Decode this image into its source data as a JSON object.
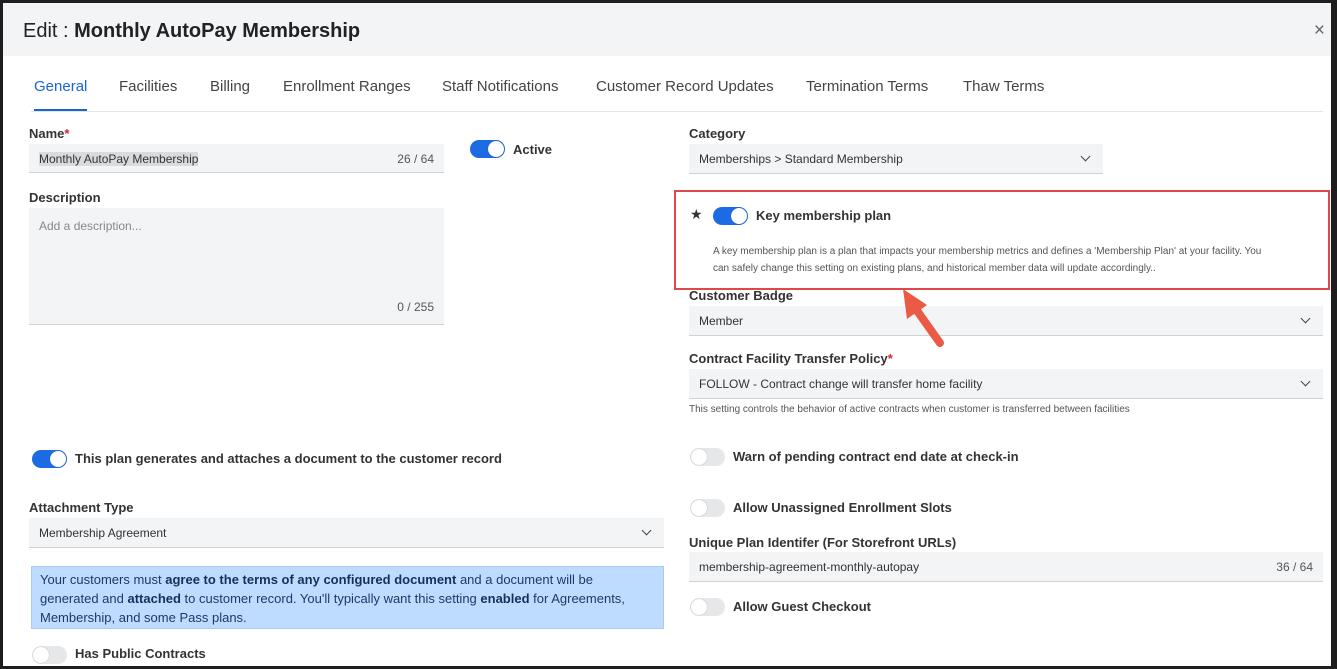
{
  "modal": {
    "title_prefix": "Edit : ",
    "title_name": "Monthly AutoPay Membership",
    "close_glyph": "×"
  },
  "tabs": [
    "General",
    "Facilities",
    "Billing",
    "Enrollment Ranges",
    "Staff Notifications",
    "Customer Record Updates",
    "Termination Terms",
    "Thaw Terms"
  ],
  "name_field": {
    "label": "Name",
    "required_mark": "*",
    "value": "Monthly AutoPay Membership",
    "counter": "26 / 64"
  },
  "active": {
    "label": "Active",
    "on": true
  },
  "description": {
    "label": "Description",
    "placeholder": "Add a description...",
    "counter": "0 / 255"
  },
  "category": {
    "label": "Category",
    "value": "Memberships > Standard Membership"
  },
  "key_plan": {
    "star_glyph": "★",
    "label": "Key membership plan",
    "on": true,
    "desc_line1": "A key membership plan is a plan that impacts your membership metrics and defines a 'Membership Plan' at your facility. You",
    "desc_line2": "can safely change this setting on existing plans, and historical member data will update accordingly.."
  },
  "customer_badge": {
    "label": "Customer Badge",
    "value": "Member"
  },
  "transfer_policy": {
    "label": "Contract Facility Transfer Policy",
    "required_mark": "*",
    "value": "FOLLOW - Contract change will transfer home facility",
    "hint": "This setting controls the behavior of active contracts when customer is transferred between facilities"
  },
  "generates_doc": {
    "label": "This plan generates and attaches a document to the customer record",
    "on": true
  },
  "warn_pending": {
    "label": "Warn of pending contract end date at check-in",
    "on": false
  },
  "attachment_type": {
    "label": "Attachment Type",
    "value": "Membership Agreement"
  },
  "unassigned_slots": {
    "label": "Allow Unassigned Enrollment Slots",
    "on": false
  },
  "unique_id": {
    "label": "Unique Plan Identifer (For Storefront URLs)",
    "value": "membership-agreement-monthly-autopay",
    "counter": "36 / 64"
  },
  "info_box": {
    "t1": "Your customers must ",
    "b1": "agree to the terms of any configured document",
    "t2": " and a document will be generated and ",
    "b2": "attached",
    "t3": " to customer record. You'll typically want this setting ",
    "b3": "enabled",
    "t4": " for Agreements, Membership, and some Pass plans."
  },
  "guest_checkout": {
    "label": "Allow Guest Checkout",
    "on": false
  },
  "public_contracts": {
    "label": "Has Public Contracts",
    "on": false
  },
  "colors": {
    "accent": "#1a64d6",
    "toggle_on": "#1d6ae5",
    "highlight_border": "#e0464b",
    "arrow": "#ea5a45",
    "info_bg": "#bedcff"
  }
}
